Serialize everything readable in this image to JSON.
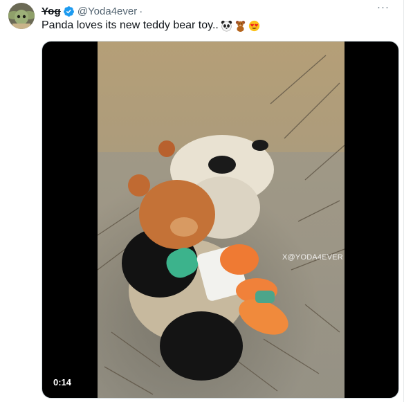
{
  "tweet": {
    "display_name": "Yog",
    "handle": "@Yoda4ever",
    "separator": "·",
    "more_label": "···",
    "text": "Panda loves its new teddy bear toy..",
    "emojis": [
      "panda-emoji",
      "teddy-bear-emoji",
      "heart-eyes-emoji"
    ],
    "verified": true
  },
  "media": {
    "type": "video",
    "watermark": "X@YODA4EVER",
    "duration": "0:14"
  },
  "colors": {
    "verified_blue": "#1d9bf0",
    "text_primary": "#0f1419",
    "text_secondary": "#536471",
    "media_bg": "#000000"
  }
}
